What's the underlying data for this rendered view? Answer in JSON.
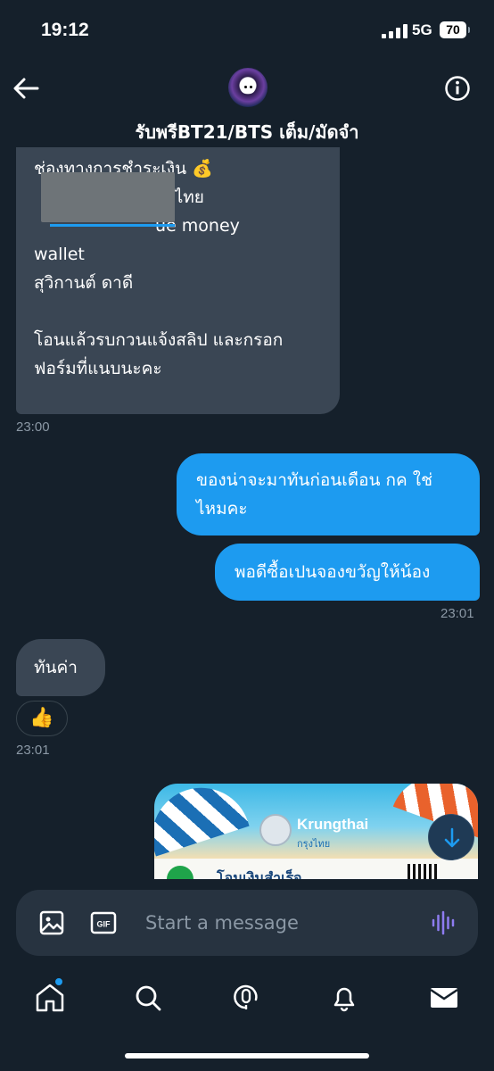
{
  "status_bar": {
    "time": "19:12",
    "network": "5G",
    "battery": "70"
  },
  "header": {
    "title": "รับพรีBT21/BTS เต็ม/มัดจำ"
  },
  "messages": {
    "incoming_1": {
      "lines": [
        "ช่องทางการชำระเงิน 💰",
        "กรไทย",
        "ue money",
        "wallet",
        "สุวิกานต์ ดาดี",
        "",
        "โอนแล้วรบกวนแจ้งสลิป และกรอก",
        "ฟอร์มที่แนบนะคะ"
      ],
      "time": "23:00"
    },
    "outgoing_1": {
      "lines": [
        "ของน่าจะมาทันก่อนเดือน กค ใช่",
        "ไหมคะ"
      ]
    },
    "outgoing_2": {
      "text": "พอดีซื้อเปนจองขวัญให้น้อง",
      "time": "23:01"
    },
    "incoming_2": {
      "text": "ทันค่า",
      "reaction": "👍",
      "time": "23:01"
    },
    "image": {
      "brand": "Krungthai",
      "brand_thai": "กรุงไทย",
      "status": "โอนเงินสำเร็จ"
    }
  },
  "composer": {
    "placeholder": "Start a message"
  },
  "colors": {
    "background": "#15202b",
    "accent": "#1d9bf0",
    "bubble_in": "#3a4654",
    "muted": "#8b98a5"
  },
  "icons": {
    "back": "arrow-left-icon",
    "info": "info-icon",
    "image": "image-icon",
    "gif": "gif-icon",
    "voice": "voice-wave-icon",
    "home": "home-icon",
    "search": "search-icon",
    "spaces": "spaces-icon",
    "notifications": "bell-icon",
    "messages": "mail-icon",
    "scroll_down": "arrow-down-icon"
  }
}
